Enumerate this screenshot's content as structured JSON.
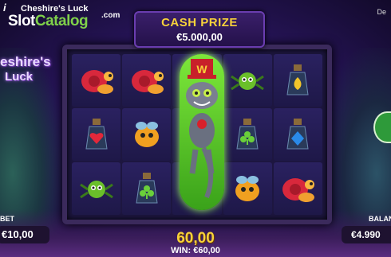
{
  "watermark": {
    "i": "i",
    "game": "Cheshire's Luck",
    "slot": "Slot",
    "catalog": "Catalog",
    "com": ".com"
  },
  "menu": "De",
  "plaque": {
    "title": "CASH PRIZE",
    "value": "€5.000,00"
  },
  "logo": {
    "line1": "eshire's",
    "line2": "Luck"
  },
  "reels": [
    [
      "snail-red",
      "snail-red",
      "wild-cat",
      "spider-green",
      "potion-yellow"
    ],
    [
      "potion-red",
      "bug-orange",
      "wild-cat",
      "potion-green",
      "potion-blue"
    ],
    [
      "spider-green",
      "potion-green",
      "wild-cat",
      "bug-orange",
      "snail-red"
    ]
  ],
  "bet": {
    "label": "BET",
    "value": "€10,00"
  },
  "balance": {
    "label": "BALAN",
    "value": "€4.990"
  },
  "win": {
    "amount": "60,00",
    "label": "WIN: €60,00"
  },
  "colors": {
    "gold": "#f7d23a",
    "wild_green": "#7de83a",
    "purple_bg": "#2a1660"
  }
}
